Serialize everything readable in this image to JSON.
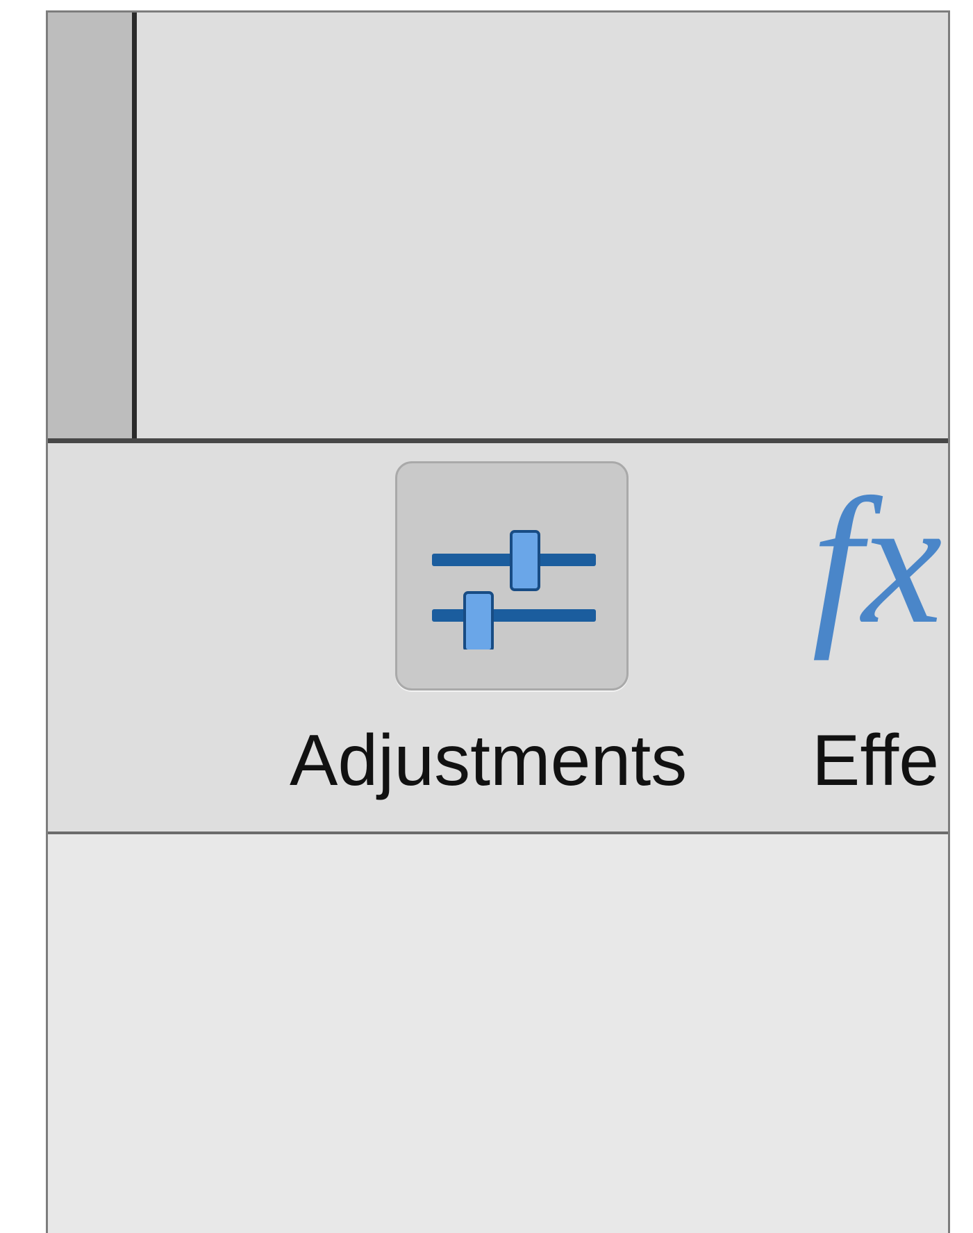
{
  "toolbar": {
    "adjustments": {
      "label": "Adjustments",
      "icon": "sliders-icon",
      "selected": true
    },
    "effects": {
      "label": "Effe",
      "icon_glyph": "fx",
      "icon": "effects-fx-icon"
    }
  },
  "colors": {
    "window_bg": "#dedede",
    "strip_bg": "#bdbdbd",
    "selected_tile_bg": "#c9c9c9",
    "icon_blue": "#4a86c9",
    "lower_panel_bg": "#e8e8e8"
  }
}
